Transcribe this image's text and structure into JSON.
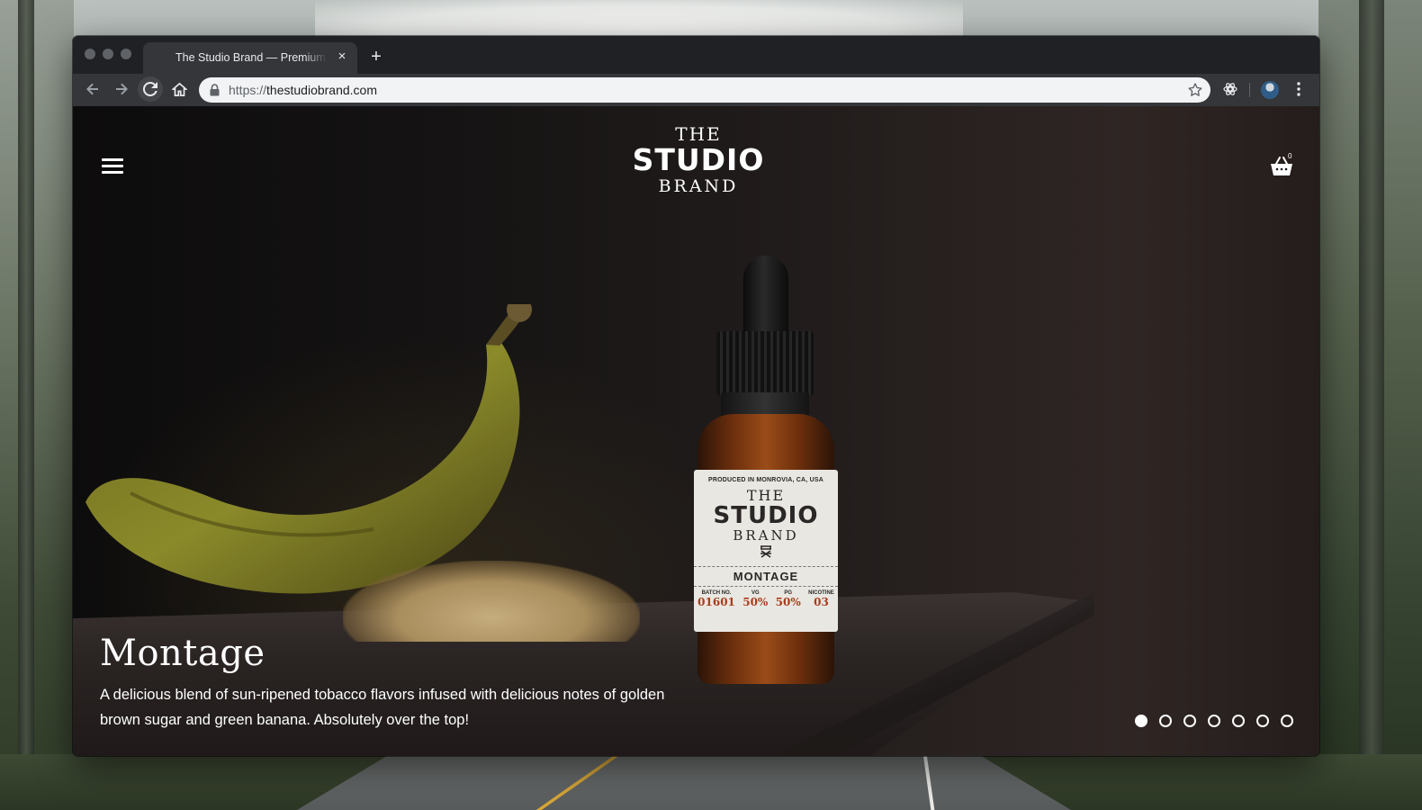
{
  "browser": {
    "tab_title": "The Studio Brand — Premium Tobacco",
    "new_tab_label": "+",
    "close_label": "×",
    "url_scheme": "https://",
    "url_host": "thestudiobrand.com"
  },
  "site": {
    "logo": {
      "line1": "THE",
      "line2": "STUDIO",
      "line3": "BRAND"
    },
    "cart_count": "0"
  },
  "product_label": {
    "produced": "PRODUCED IN MONROVIA, CA, USA",
    "the": "THE",
    "studio": "STUDIO",
    "brand": "BRAND",
    "flavor": "MONTAGE",
    "specs": [
      {
        "label": "BATCH NO.",
        "value": "01601"
      },
      {
        "label": "VG",
        "value": "50%"
      },
      {
        "label": "PG",
        "value": "50%"
      },
      {
        "label": "NICOTINE",
        "value": "03"
      }
    ]
  },
  "hero": {
    "title": "Montage",
    "description": "A delicious blend of sun-ripened tobacco flavors infused with delicious notes of golden brown sugar and green banana. Absolutely over the top!",
    "slide_count": 7,
    "active_slide": 1
  },
  "colors": {
    "accent_red": "#a93d1c",
    "chrome_dark": "#202124",
    "chrome_toolbar": "#35363a"
  },
  "icons": [
    "back-icon",
    "forward-icon",
    "reload-icon",
    "home-icon",
    "lock-icon",
    "star-icon",
    "extension-icon",
    "avatar",
    "menu-icon",
    "hamburger-icon",
    "cart-icon"
  ]
}
